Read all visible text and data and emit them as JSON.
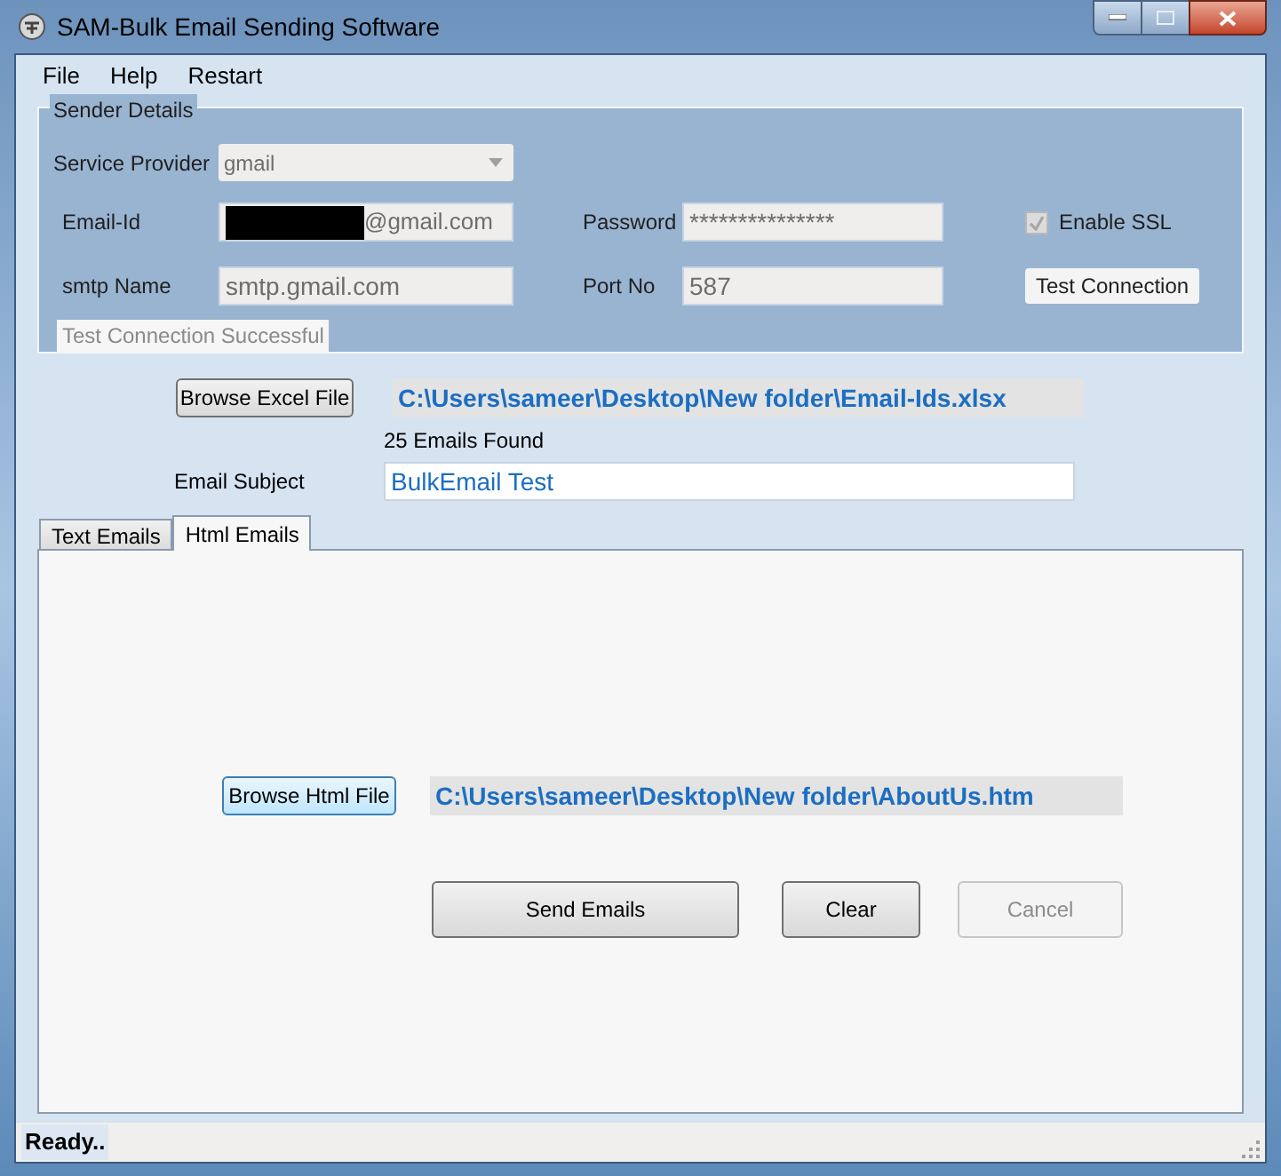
{
  "window": {
    "title": "SAM-Bulk Email Sending Software"
  },
  "menu": [
    "File",
    "Help",
    "Restart"
  ],
  "sender_details": {
    "legend": "Sender Details",
    "service_provider": {
      "label": "Service Provider",
      "value": "gmail"
    },
    "email_id": {
      "label": "Email-Id",
      "value": "@gmail.com",
      "redacted": true
    },
    "password": {
      "label": "Password",
      "value": "***************"
    },
    "enable_ssl": {
      "label": "Enable SSL",
      "checked": true,
      "disabled": true
    },
    "smtp_name": {
      "label": "smtp Name",
      "value": "smtp.gmail.com"
    },
    "port_no": {
      "label": "Port No",
      "value": "587"
    },
    "test_button": "Test Connection",
    "status": "Test Connection Successful"
  },
  "excel": {
    "button": "Browse Excel File",
    "path": "C:\\Users\\sameer\\Desktop\\New folder\\Email-Ids.xlsx",
    "found": "25 Emails Found"
  },
  "subject": {
    "label": "Email Subject",
    "value": "BulkEmail Test"
  },
  "tabs": [
    {
      "label": "Text Emails",
      "selected": false
    },
    {
      "label": "Html Emails",
      "selected": true
    }
  ],
  "html_panel": {
    "button": "Browse Html File",
    "path": "C:\\Users\\sameer\\Desktop\\New folder\\AboutUs.htm"
  },
  "actions": [
    {
      "label": "Send Emails",
      "disabled": false
    },
    {
      "label": "Clear",
      "disabled": false
    },
    {
      "label": "Cancel",
      "disabled": true
    }
  ],
  "status_bar": "Ready.."
}
